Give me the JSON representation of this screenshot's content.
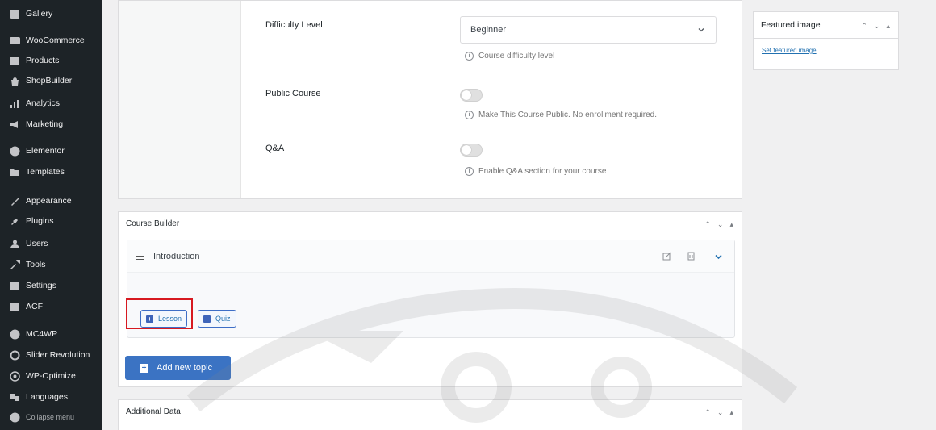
{
  "sidebar": {
    "items": [
      {
        "label": "Gallery",
        "icon": "gallery-icon"
      },
      {
        "label": "WooCommerce",
        "icon": "woocommerce-icon"
      },
      {
        "label": "Products",
        "icon": "products-icon"
      },
      {
        "label": "ShopBuilder",
        "icon": "shopbuilder-icon"
      },
      {
        "label": "Analytics",
        "icon": "analytics-icon"
      },
      {
        "label": "Marketing",
        "icon": "marketing-icon"
      },
      {
        "label": "Elementor",
        "icon": "elementor-icon"
      },
      {
        "label": "Templates",
        "icon": "templates-icon"
      },
      {
        "label": "Appearance",
        "icon": "appearance-icon"
      },
      {
        "label": "Plugins",
        "icon": "plugins-icon"
      },
      {
        "label": "Users",
        "icon": "users-icon"
      },
      {
        "label": "Tools",
        "icon": "tools-icon"
      },
      {
        "label": "Settings",
        "icon": "settings-icon"
      },
      {
        "label": "ACF",
        "icon": "acf-icon"
      },
      {
        "label": "MC4WP",
        "icon": "mc4wp-icon"
      },
      {
        "label": "Slider Revolution",
        "icon": "slider-revolution-icon"
      },
      {
        "label": "WP-Optimize",
        "icon": "wp-optimize-icon"
      },
      {
        "label": "Languages",
        "icon": "languages-icon"
      },
      {
        "label": "Collapse menu",
        "icon": "collapse-icon"
      }
    ]
  },
  "settings": {
    "difficulty_label": "Difficulty Level",
    "difficulty_value": "Beginner",
    "difficulty_hint": "Course difficulty level",
    "public_label": "Public Course",
    "public_hint": "Make This Course Public. No enrollment required.",
    "qa_label": "Q&A",
    "qa_hint": "Enable Q&A section for your course"
  },
  "featured": {
    "title": "Featured image",
    "link": "Set featured image"
  },
  "builder": {
    "title": "Course Builder",
    "topic_title": "Introduction",
    "lesson_label": "Lesson",
    "quiz_label": "Quiz",
    "add_topic_label": "Add new topic"
  },
  "additional": {
    "title": "Additional Data"
  },
  "colors": {
    "accent": "#3b73c3",
    "highlight": "#d71920",
    "sidebar_bg": "#1d2327"
  }
}
